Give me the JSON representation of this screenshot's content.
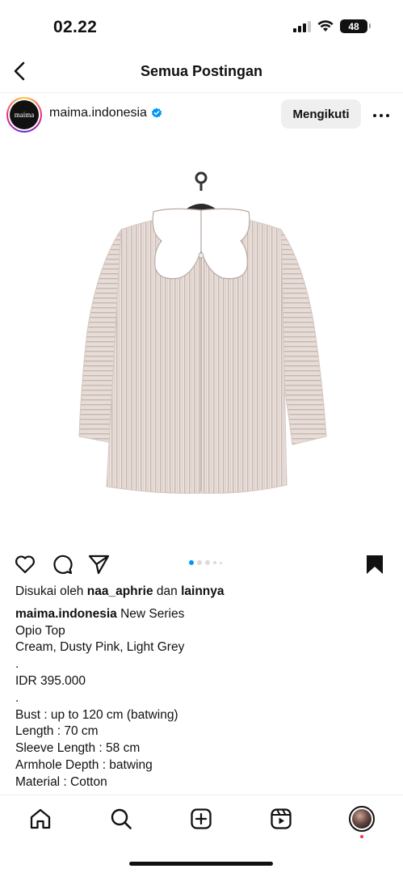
{
  "status_bar": {
    "time": "02.22",
    "battery": "48"
  },
  "header": {
    "title": "Semua Postingan"
  },
  "post": {
    "username": "maima.indonesia",
    "avatar_text": "maima",
    "follow_label": "Mengikuti",
    "image_alt": "Opio Top blouse on hanger",
    "carousel_total": 5,
    "carousel_active": 1,
    "likes": {
      "prefix": "Disukai oleh",
      "user": "naa_aphrie",
      "conj": "dan",
      "others": "lainnya"
    },
    "caption": {
      "author": "maima.indonesia",
      "first_line": "New Series",
      "lines": [
        "Opio Top",
        "Cream, Dusty Pink, Light Grey",
        ".",
        "IDR 395.000",
        ".",
        "Bust : up to 120 cm (batwing)",
        "Length : 70 cm",
        "Sleeve Length : 58 cm",
        "Armhole Depth : batwing",
        "Material : Cotton"
      ]
    }
  },
  "bottom_nav": [
    "home-icon",
    "search-icon",
    "create-icon",
    "reels-icon",
    "profile-avatar"
  ],
  "colors": {
    "accent_blue": "#0095f6",
    "text": "#111111",
    "muted_bg": "#efefef"
  }
}
